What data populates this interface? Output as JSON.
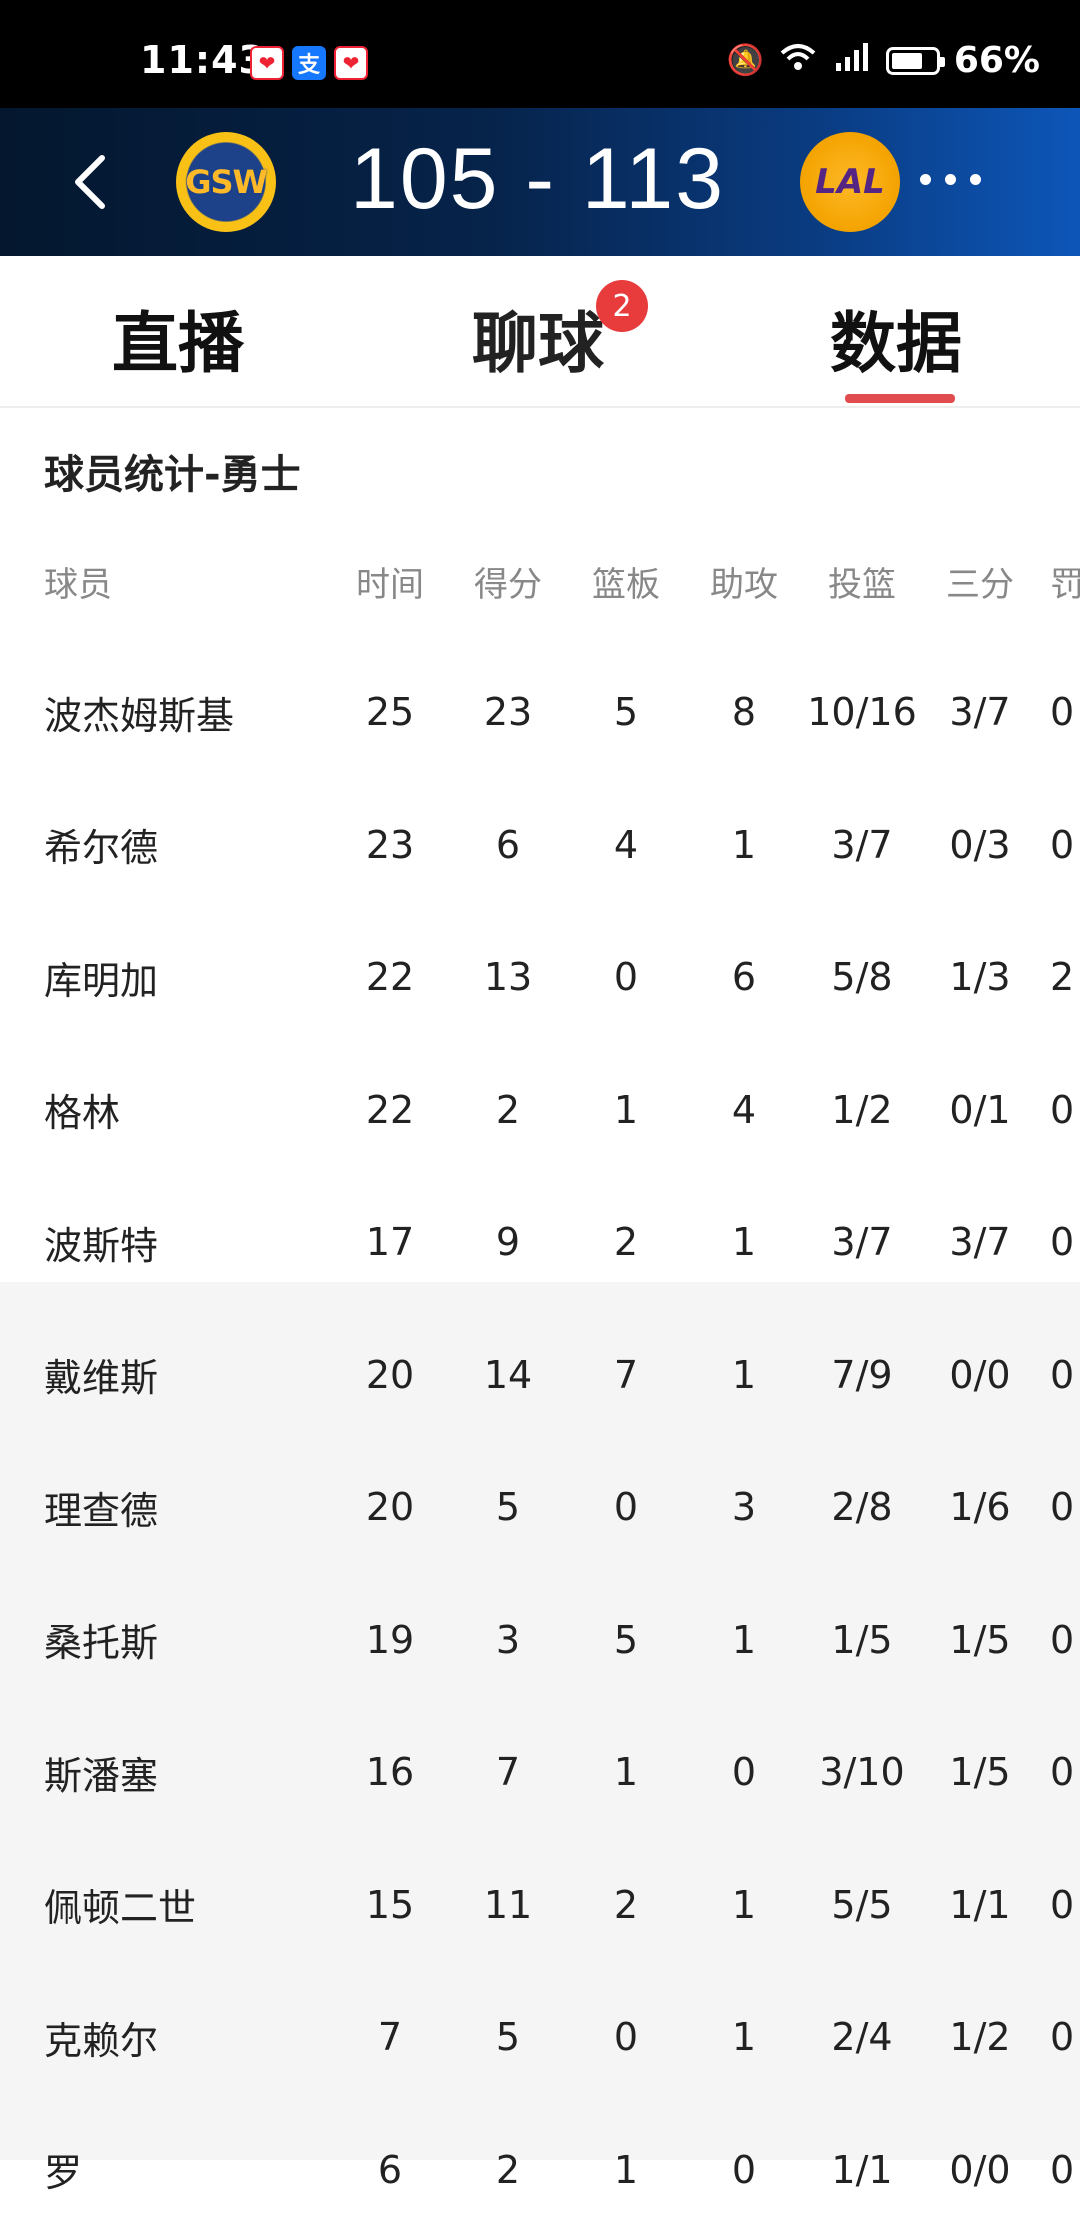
{
  "status_bar": {
    "time": "11:43",
    "battery": "66%",
    "battery_level": 0.66
  },
  "score_header": {
    "home_team_logo": "GSW",
    "away_team_logo": "LAL",
    "score": "105 - 113"
  },
  "tabs": [
    {
      "label": "直播"
    },
    {
      "label": "聊球",
      "badge": "2"
    },
    {
      "label": "数据",
      "active": true
    }
  ],
  "section_title": "球员统计-勇士",
  "table": {
    "headers": [
      "球员",
      "时间",
      "得分",
      "篮板",
      "助攻",
      "投篮",
      "三分",
      "罚"
    ],
    "rows": [
      [
        "波杰姆斯基",
        "25",
        "23",
        "5",
        "8",
        "10/16",
        "3/7",
        "0"
      ],
      [
        "希尔德",
        "23",
        "6",
        "4",
        "1",
        "3/7",
        "0/3",
        "0"
      ],
      [
        "库明加",
        "22",
        "13",
        "0",
        "6",
        "5/8",
        "1/3",
        "2"
      ],
      [
        "格林",
        "22",
        "2",
        "1",
        "4",
        "1/2",
        "0/1",
        "0"
      ],
      [
        "波斯特",
        "17",
        "9",
        "2",
        "1",
        "3/7",
        "3/7",
        "0"
      ],
      [
        "戴维斯",
        "20",
        "14",
        "7",
        "1",
        "7/9",
        "0/0",
        "0"
      ],
      [
        "理查德",
        "20",
        "5",
        "0",
        "3",
        "2/8",
        "1/6",
        "0"
      ],
      [
        "桑托斯",
        "19",
        "3",
        "5",
        "1",
        "1/5",
        "1/5",
        "0"
      ],
      [
        "斯潘塞",
        "16",
        "7",
        "1",
        "0",
        "3/10",
        "1/5",
        "0"
      ],
      [
        "佩顿二世",
        "15",
        "11",
        "2",
        "1",
        "5/5",
        "1/1",
        "0"
      ],
      [
        "克赖尔",
        "7",
        "5",
        "0",
        "1",
        "2/4",
        "1/2",
        "0"
      ],
      [
        "罗",
        "6",
        "2",
        "1",
        "0",
        "1/1",
        "0/0",
        "0"
      ]
    ]
  }
}
